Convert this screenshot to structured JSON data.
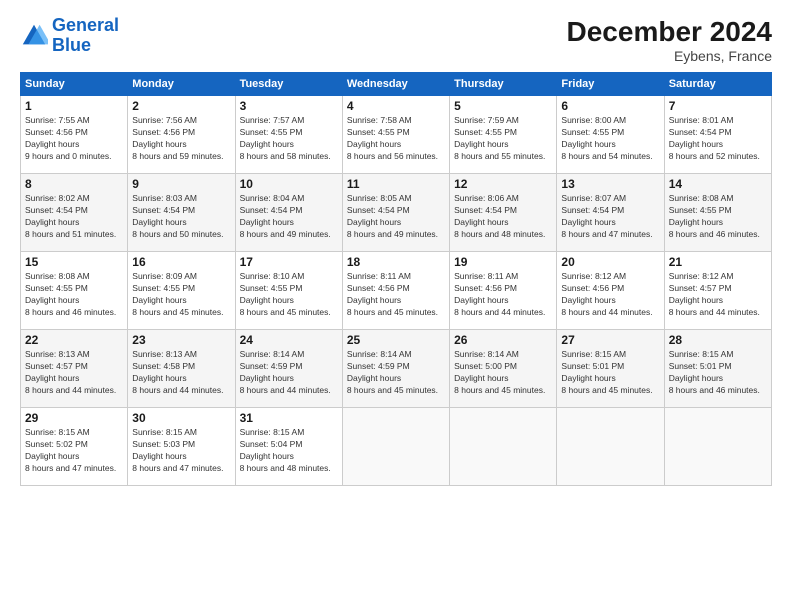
{
  "logo": {
    "line1": "General",
    "line2": "Blue"
  },
  "title": "December 2024",
  "location": "Eybens, France",
  "days_of_week": [
    "Sunday",
    "Monday",
    "Tuesday",
    "Wednesday",
    "Thursday",
    "Friday",
    "Saturday"
  ],
  "weeks": [
    [
      {
        "day": "1",
        "sunrise": "7:55 AM",
        "sunset": "4:56 PM",
        "daylight": "9 hours and 0 minutes."
      },
      {
        "day": "2",
        "sunrise": "7:56 AM",
        "sunset": "4:56 PM",
        "daylight": "8 hours and 59 minutes."
      },
      {
        "day": "3",
        "sunrise": "7:57 AM",
        "sunset": "4:55 PM",
        "daylight": "8 hours and 58 minutes."
      },
      {
        "day": "4",
        "sunrise": "7:58 AM",
        "sunset": "4:55 PM",
        "daylight": "8 hours and 56 minutes."
      },
      {
        "day": "5",
        "sunrise": "7:59 AM",
        "sunset": "4:55 PM",
        "daylight": "8 hours and 55 minutes."
      },
      {
        "day": "6",
        "sunrise": "8:00 AM",
        "sunset": "4:55 PM",
        "daylight": "8 hours and 54 minutes."
      },
      {
        "day": "7",
        "sunrise": "8:01 AM",
        "sunset": "4:54 PM",
        "daylight": "8 hours and 52 minutes."
      }
    ],
    [
      {
        "day": "8",
        "sunrise": "8:02 AM",
        "sunset": "4:54 PM",
        "daylight": "8 hours and 51 minutes."
      },
      {
        "day": "9",
        "sunrise": "8:03 AM",
        "sunset": "4:54 PM",
        "daylight": "8 hours and 50 minutes."
      },
      {
        "day": "10",
        "sunrise": "8:04 AM",
        "sunset": "4:54 PM",
        "daylight": "8 hours and 49 minutes."
      },
      {
        "day": "11",
        "sunrise": "8:05 AM",
        "sunset": "4:54 PM",
        "daylight": "8 hours and 49 minutes."
      },
      {
        "day": "12",
        "sunrise": "8:06 AM",
        "sunset": "4:54 PM",
        "daylight": "8 hours and 48 minutes."
      },
      {
        "day": "13",
        "sunrise": "8:07 AM",
        "sunset": "4:54 PM",
        "daylight": "8 hours and 47 minutes."
      },
      {
        "day": "14",
        "sunrise": "8:08 AM",
        "sunset": "4:55 PM",
        "daylight": "8 hours and 46 minutes."
      }
    ],
    [
      {
        "day": "15",
        "sunrise": "8:08 AM",
        "sunset": "4:55 PM",
        "daylight": "8 hours and 46 minutes."
      },
      {
        "day": "16",
        "sunrise": "8:09 AM",
        "sunset": "4:55 PM",
        "daylight": "8 hours and 45 minutes."
      },
      {
        "day": "17",
        "sunrise": "8:10 AM",
        "sunset": "4:55 PM",
        "daylight": "8 hours and 45 minutes."
      },
      {
        "day": "18",
        "sunrise": "8:11 AM",
        "sunset": "4:56 PM",
        "daylight": "8 hours and 45 minutes."
      },
      {
        "day": "19",
        "sunrise": "8:11 AM",
        "sunset": "4:56 PM",
        "daylight": "8 hours and 44 minutes."
      },
      {
        "day": "20",
        "sunrise": "8:12 AM",
        "sunset": "4:56 PM",
        "daylight": "8 hours and 44 minutes."
      },
      {
        "day": "21",
        "sunrise": "8:12 AM",
        "sunset": "4:57 PM",
        "daylight": "8 hours and 44 minutes."
      }
    ],
    [
      {
        "day": "22",
        "sunrise": "8:13 AM",
        "sunset": "4:57 PM",
        "daylight": "8 hours and 44 minutes."
      },
      {
        "day": "23",
        "sunrise": "8:13 AM",
        "sunset": "4:58 PM",
        "daylight": "8 hours and 44 minutes."
      },
      {
        "day": "24",
        "sunrise": "8:14 AM",
        "sunset": "4:59 PM",
        "daylight": "8 hours and 44 minutes."
      },
      {
        "day": "25",
        "sunrise": "8:14 AM",
        "sunset": "4:59 PM",
        "daylight": "8 hours and 45 minutes."
      },
      {
        "day": "26",
        "sunrise": "8:14 AM",
        "sunset": "5:00 PM",
        "daylight": "8 hours and 45 minutes."
      },
      {
        "day": "27",
        "sunrise": "8:15 AM",
        "sunset": "5:01 PM",
        "daylight": "8 hours and 45 minutes."
      },
      {
        "day": "28",
        "sunrise": "8:15 AM",
        "sunset": "5:01 PM",
        "daylight": "8 hours and 46 minutes."
      }
    ],
    [
      {
        "day": "29",
        "sunrise": "8:15 AM",
        "sunset": "5:02 PM",
        "daylight": "8 hours and 47 minutes."
      },
      {
        "day": "30",
        "sunrise": "8:15 AM",
        "sunset": "5:03 PM",
        "daylight": "8 hours and 47 minutes."
      },
      {
        "day": "31",
        "sunrise": "8:15 AM",
        "sunset": "5:04 PM",
        "daylight": "8 hours and 48 minutes."
      },
      null,
      null,
      null,
      null
    ]
  ]
}
